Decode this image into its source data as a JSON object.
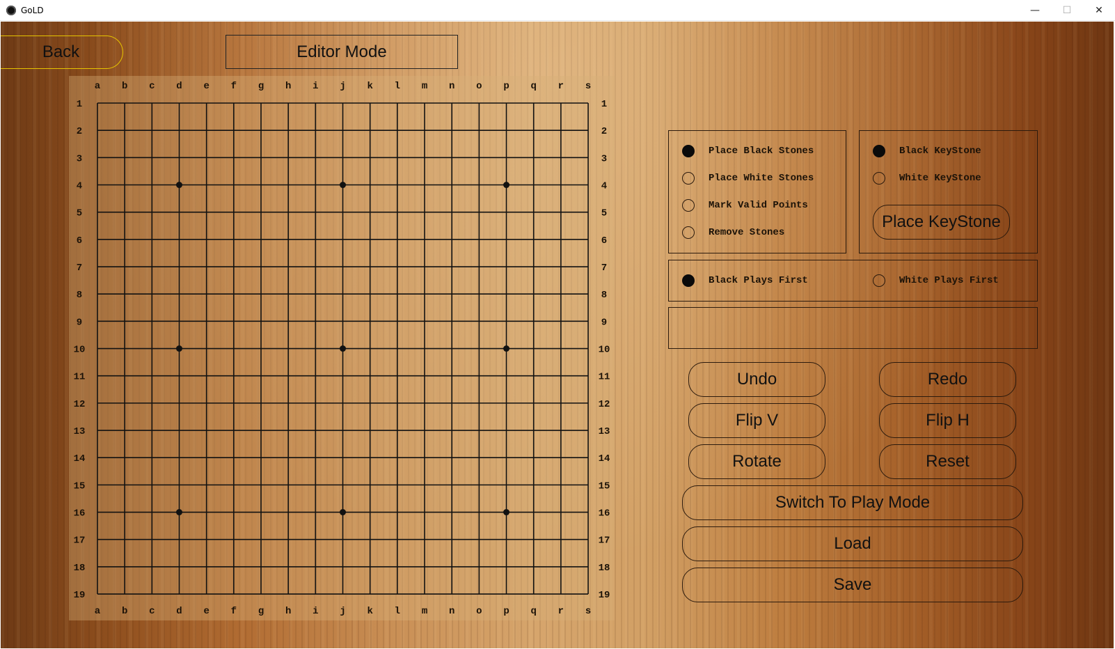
{
  "window": {
    "title": "GoLD",
    "minimize": "—",
    "maximize": "☐",
    "close": "✕"
  },
  "header": {
    "back_label": "Back",
    "mode_label": "Editor Mode"
  },
  "board": {
    "size": 19,
    "column_labels": [
      "a",
      "b",
      "c",
      "d",
      "e",
      "f",
      "g",
      "h",
      "i",
      "j",
      "k",
      "l",
      "m",
      "n",
      "o",
      "p",
      "q",
      "r",
      "s"
    ],
    "row_labels": [
      "1",
      "2",
      "3",
      "4",
      "5",
      "6",
      "7",
      "8",
      "9",
      "10",
      "11",
      "12",
      "13",
      "14",
      "15",
      "16",
      "17",
      "18",
      "19"
    ],
    "star_points": [
      [
        3,
        3
      ],
      [
        9,
        3
      ],
      [
        15,
        3
      ],
      [
        3,
        9
      ],
      [
        9,
        9
      ],
      [
        15,
        9
      ],
      [
        3,
        15
      ],
      [
        9,
        15
      ],
      [
        15,
        15
      ]
    ]
  },
  "tool_options": [
    {
      "label": "Place Black Stones",
      "checked": true
    },
    {
      "label": "Place White Stones",
      "checked": false
    },
    {
      "label": "Mark Valid Points",
      "checked": false
    },
    {
      "label": "Remove Stones",
      "checked": false
    }
  ],
  "keystone_options": [
    {
      "label": "Black KeyStone",
      "checked": true
    },
    {
      "label": "White KeyStone",
      "checked": false
    }
  ],
  "place_keystone_label": "Place KeyStone",
  "first_player_options": [
    {
      "label": "Black Plays First",
      "checked": true
    },
    {
      "label": "White Plays First",
      "checked": false
    }
  ],
  "message_text": "",
  "buttons": {
    "undo": "Undo",
    "redo": "Redo",
    "flip_v": "Flip V",
    "flip_h": "Flip H",
    "rotate": "Rotate",
    "reset": "Reset",
    "switch_mode": "Switch To Play Mode",
    "load": "Load",
    "save": "Save"
  }
}
